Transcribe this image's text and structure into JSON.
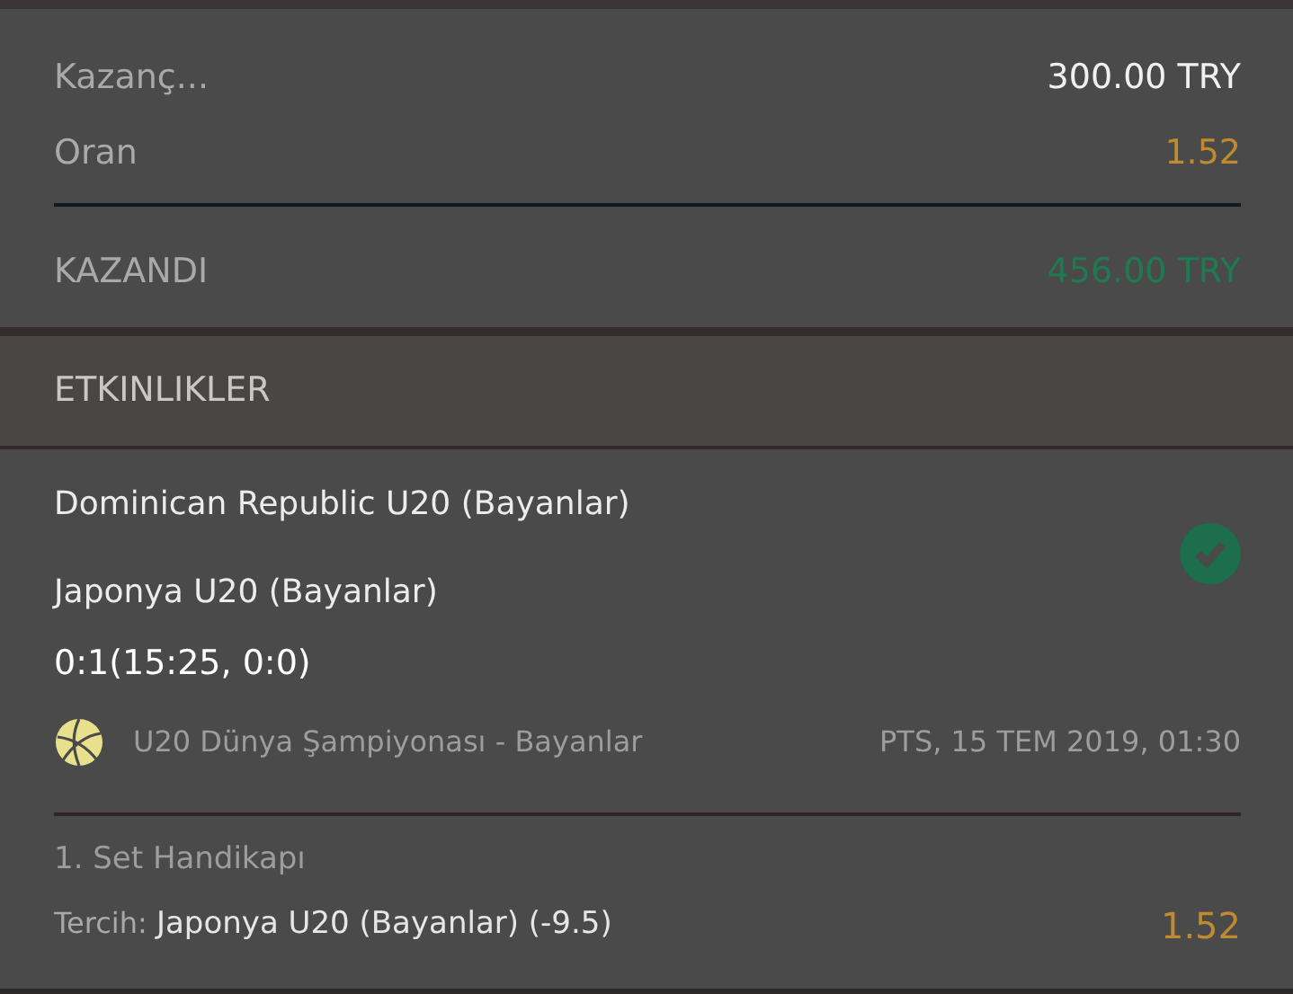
{
  "summary": {
    "rows": [
      {
        "label": "Kazanç...",
        "value": "300.00 TRY",
        "kind": "amount"
      },
      {
        "label": "Oran",
        "value": "1.52",
        "kind": "odds"
      }
    ],
    "result": {
      "label": "KAZANDI",
      "value": "456.00 TRY"
    }
  },
  "section": {
    "title": "ETKINLIKLER"
  },
  "event": {
    "home": "Dominican Republic U20 (Bayanlar)",
    "away": "Japonya U20 (Bayanlar)",
    "won": true,
    "score": "0:1(15:25, 0:0)",
    "league": "U20 Dünya Şampiyonası - Bayanlar",
    "date": "PTS, 15 TEM 2019, 01:30",
    "market": "1. Set Handikapı",
    "pick_label": "Tercih:",
    "pick": "Japonya U20 (Bayanlar) (-9.5)",
    "odds": "1.52"
  }
}
